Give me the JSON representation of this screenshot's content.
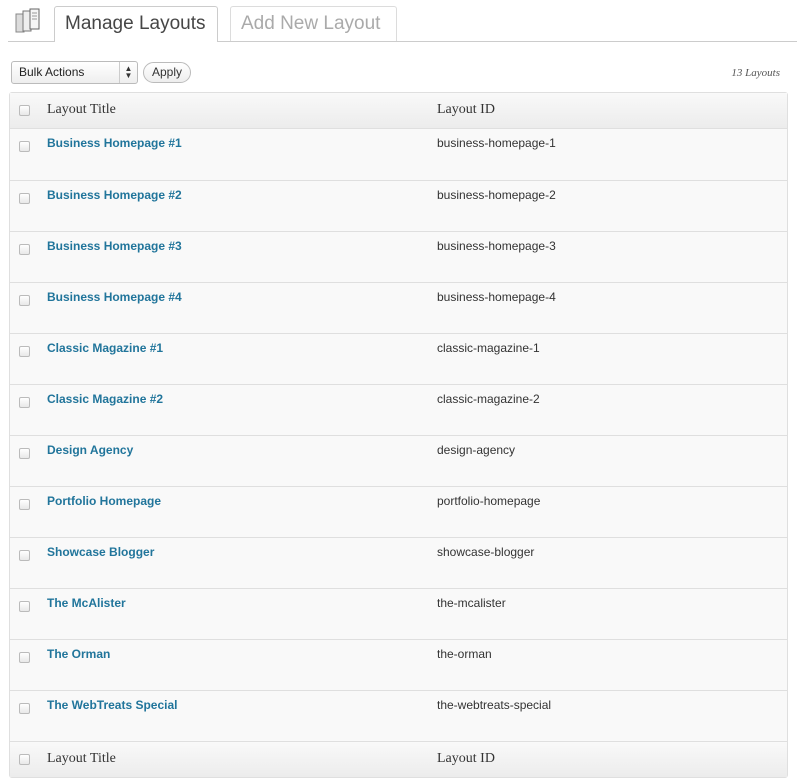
{
  "header": {
    "tabs": [
      {
        "label": "Manage Layouts",
        "active": true
      },
      {
        "label": "Add New Layout",
        "active": false
      }
    ],
    "icon": "layouts-page-icon"
  },
  "toolbar": {
    "bulk_actions": "Bulk Actions",
    "apply_label": "Apply",
    "count_text": "13 Layouts"
  },
  "table": {
    "columns": [
      "Layout Title",
      "Layout ID"
    ],
    "rows": [
      {
        "title": "Business Homepage #1",
        "id": "business-homepage-1"
      },
      {
        "title": "Business Homepage #2",
        "id": "business-homepage-2"
      },
      {
        "title": "Business Homepage #3",
        "id": "business-homepage-3"
      },
      {
        "title": "Business Homepage #4",
        "id": "business-homepage-4"
      },
      {
        "title": "Classic Magazine #1",
        "id": "classic-magazine-1"
      },
      {
        "title": "Classic Magazine #2",
        "id": "classic-magazine-2"
      },
      {
        "title": "Design Agency",
        "id": "design-agency"
      },
      {
        "title": "Portfolio Homepage",
        "id": "portfolio-homepage"
      },
      {
        "title": "Showcase Blogger",
        "id": "showcase-blogger"
      },
      {
        "title": "The McAlister",
        "id": "the-mcalister"
      },
      {
        "title": "The Orman",
        "id": "the-orman"
      },
      {
        "title": "The WebTreats Special",
        "id": "the-webtreats-special"
      }
    ]
  },
  "colors": {
    "link": "#21759b",
    "row_bg": "#f9f9f9",
    "border": "#dfdfdf"
  }
}
